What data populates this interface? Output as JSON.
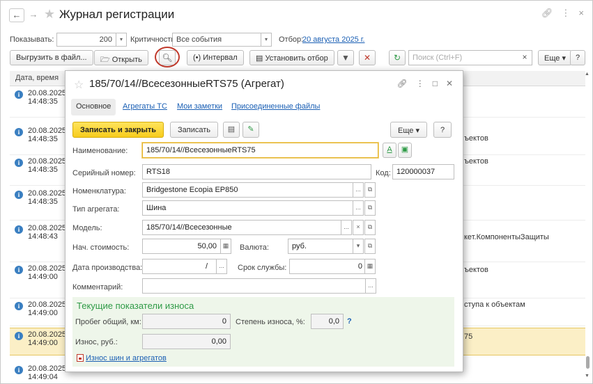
{
  "window": {
    "title": "Журнал регистрации",
    "back_glyph": "←",
    "forward_glyph": "→"
  },
  "filters": {
    "show_label": "Показывать:",
    "show_value": "200",
    "criticality_label": "Критичность:",
    "criticality_value": "Все события",
    "selection_label": "Отбор:",
    "selection_link": "20 августа 2025 г."
  },
  "toolbar": {
    "export_label": "Выгрузить в файл...",
    "open_label": "Открыть",
    "interval_label": "(•) Интервал",
    "set_filter_label": "Установить отбор",
    "search_placeholder": "Поиск (Ctrl+F)",
    "more_label": "Еще",
    "help_label": "?"
  },
  "table": {
    "header_date": "Дата, время",
    "rows": [
      {
        "date": "20.08.2025",
        "time": "14:48:35",
        "text": ""
      },
      {
        "date": "20.08.2025",
        "time": "14:48:35",
        "text": "ъектов"
      },
      {
        "date": "20.08.2025",
        "time": "14:48:35",
        "text": "ъектов"
      },
      {
        "date": "20.08.2025",
        "time": "14:48:35",
        "text": ""
      },
      {
        "date": "20.08.2025",
        "time": "14:48:43",
        "text": "кет.КомпонентыЗащиты"
      },
      {
        "date": "20.08.2025",
        "time": "14:49:00",
        "text": "ъектов"
      },
      {
        "date": "20.08.2025",
        "time": "14:49:00",
        "text": "ступа к объектам"
      },
      {
        "date": "20.08.2025",
        "time": "14:49:00",
        "text": "75"
      },
      {
        "date": "20.08.2025",
        "time": "14:49:04",
        "text": ""
      }
    ]
  },
  "dialog": {
    "title": "185/70/14//ВсесезонныеRTS75 (Агрегат)",
    "tabs": [
      "Основное",
      "Агрегаты ТС",
      "Мои заметки",
      "Присоединенные файлы"
    ],
    "save_close_label": "Записать и закрыть",
    "save_label": "Записать",
    "more_label": "Еще",
    "help_label": "?",
    "fields": {
      "name_label": "Наименование:",
      "name_value": "185/70/14//ВсесезонныеRTS75",
      "serial_label": "Серийный номер:",
      "serial_value": "RTS18",
      "code_label": "Код:",
      "code_value": "120000037",
      "nomenclature_label": "Номенклатура:",
      "nomenclature_value": "Bridgestone Ecopia EP850",
      "unit_type_label": "Тип агрегата:",
      "unit_type_value": "Шина",
      "model_label": "Модель:",
      "model_value": "185/70/14//Всесезонные",
      "cost_label": "Нач. стоимость:",
      "cost_value": "50,00",
      "currency_label": "Валюта:",
      "currency_value": "руб.",
      "prod_date_label": "Дата производства:",
      "prod_date_value": "/",
      "service_life_label": "Срок службы:",
      "service_life_value": "0",
      "comment_label": "Комментарий:"
    },
    "wear": {
      "title": "Текущие показатели износа",
      "mileage_label": "Пробег общий, км:",
      "mileage_value": "0",
      "degree_label": "Степень износа, %:",
      "degree_value": "0,0",
      "degree_help": "?",
      "wear_rub_label": "Износ, руб.:",
      "wear_rub_value": "0,00",
      "report_link": "Износ шин и агрегатов"
    }
  }
}
